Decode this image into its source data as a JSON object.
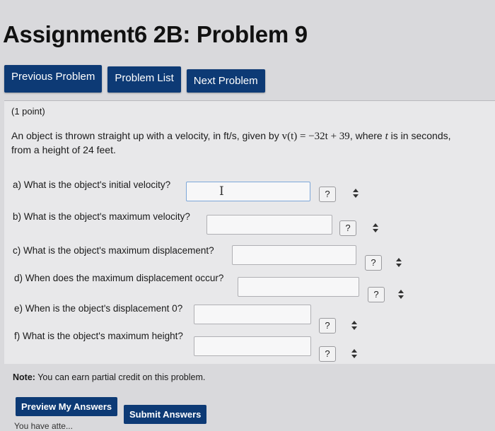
{
  "page": {
    "title": "Assignment6 2B: Problem 9"
  },
  "nav": {
    "previous": "Previous Problem",
    "list": "Problem List",
    "next": "Next Problem"
  },
  "problem": {
    "points": "(1 point)",
    "statement_pre": "An object is thrown straight up with a velocity, in ft/s, given by ",
    "formula": "v(t) = −32t + 39",
    "statement_mid": ", where ",
    "variable": "t",
    "statement_post": " is in seconds, from a height of 24 feet.",
    "questions": [
      {
        "label": "a) What is the object's initial velocity?",
        "value": ""
      },
      {
        "label": "b) What is the object's maximum velocity?",
        "value": ""
      },
      {
        "label": "c) What is the object's maximum displacement?",
        "value": ""
      },
      {
        "label": "d) When does the maximum displacement occur?",
        "value": ""
      },
      {
        "label": "e) When is the object's displacement 0?",
        "value": ""
      },
      {
        "label": "f) What is the object's maximum height?",
        "value": ""
      }
    ],
    "help_label": "?",
    "cursor_glyph": "I"
  },
  "note": {
    "bold": "Note:",
    "text": " You can earn partial credit on this problem."
  },
  "actions": {
    "preview": "Preview My Answers",
    "submit": "Submit Answers"
  },
  "footer": {
    "text": "You have atte..."
  },
  "colors": {
    "button": "#0d3a75",
    "background": "#d9d9dc"
  }
}
